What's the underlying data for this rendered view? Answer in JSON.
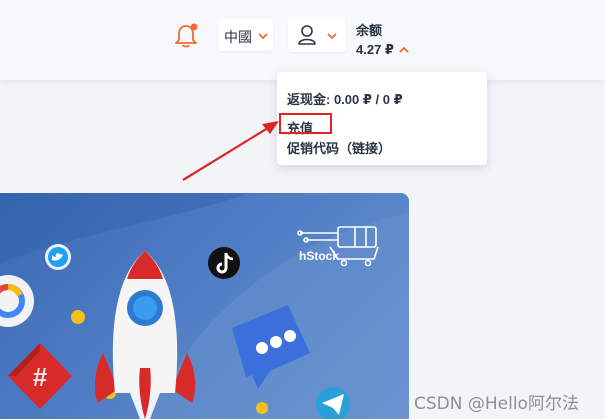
{
  "header": {
    "language_label": "中國",
    "balance_label": "余额",
    "balance_value": "4.27 ₽"
  },
  "dropdown": {
    "cashback_text": "返现金: 0.00 ₽ / 0 ₽",
    "recharge_label": "充值",
    "promo_label": "促销代码（链接）"
  },
  "banner": {
    "logo_text": "hStock"
  },
  "watermark": "CSDN @Hello阿尔法",
  "colors": {
    "accent": "#f26a2e",
    "highlight": "#e02424",
    "banner": "#4f7dc4"
  }
}
